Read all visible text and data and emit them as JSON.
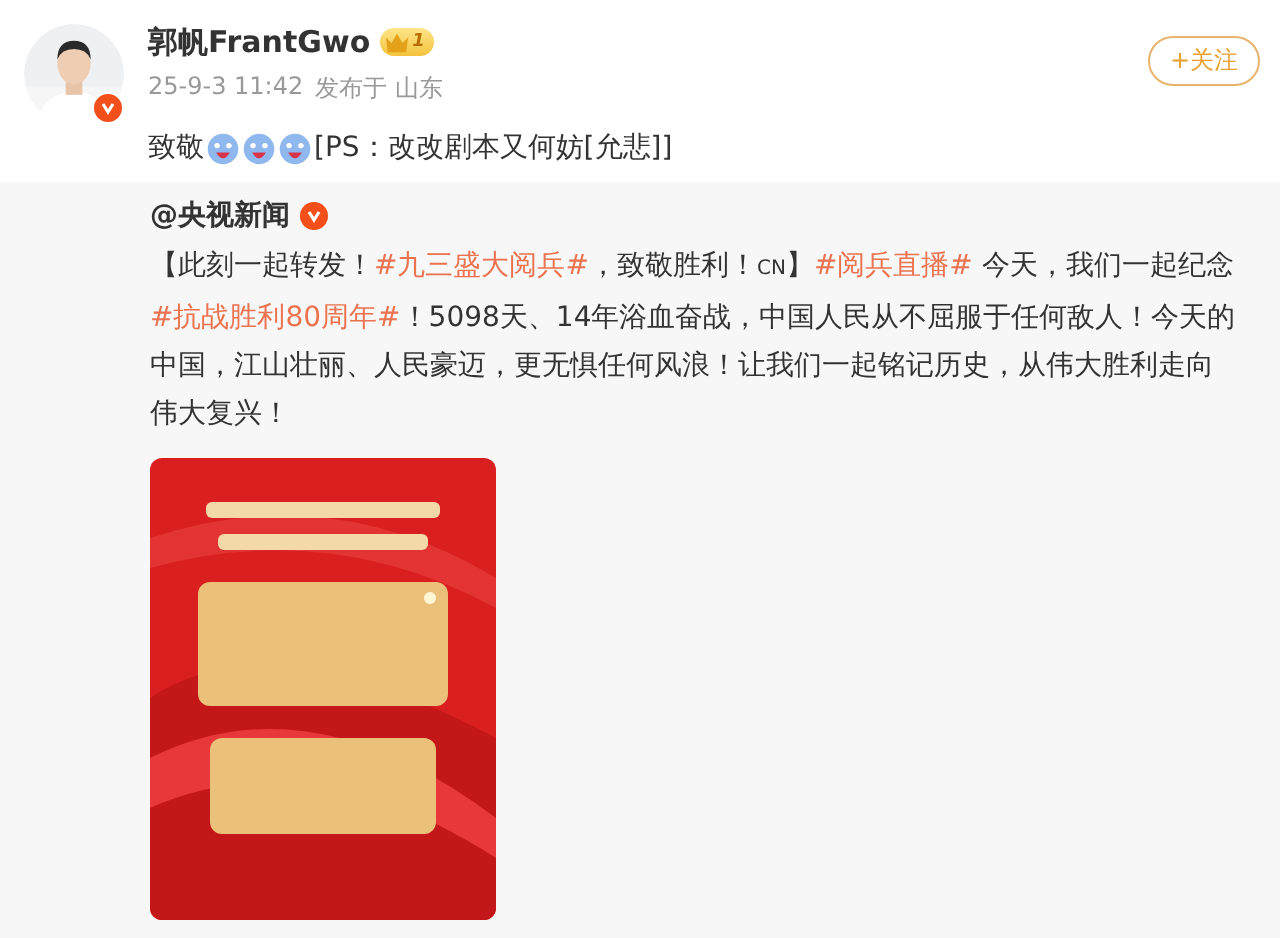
{
  "post": {
    "author": "郭帆FrantGwo",
    "level": "1",
    "verified": true,
    "time": "25-9-3 11:42",
    "location": "发布于 山东",
    "follow_button": "+关注",
    "body": [
      {
        "kind": "text",
        "text": "致敬"
      },
      {
        "kind": "emoji"
      },
      {
        "kind": "emoji"
      },
      {
        "kind": "emoji"
      },
      {
        "kind": "text",
        "text": "[PS：改改剧本又何妨[允悲]]"
      }
    ]
  },
  "repost": {
    "author": "@央视新闻",
    "verified": true,
    "segments": [
      {
        "kind": "text",
        "text": "【此刻一起转发！"
      },
      {
        "kind": "topic",
        "text": "#九三盛大阅兵#"
      },
      {
        "kind": "text",
        "text": "，致敬胜利！"
      },
      {
        "kind": "link",
        "text": "CN"
      },
      {
        "kind": "text",
        "text": "】"
      },
      {
        "kind": "topic",
        "text": "#阅兵直播#"
      },
      {
        "kind": "text",
        "text": " 今天，我们一起纪念"
      },
      {
        "kind": "topic",
        "text": "#抗战胜利80周年#"
      },
      {
        "kind": "text",
        "text": "！5098天、14年浴血奋战，中国人民从不屈服于任何敌人！今天的中国，江山壮丽、人民豪迈，更无惧任何风浪！让我们一起铭记历史，从伟大胜利走向伟大复兴！"
      }
    ]
  }
}
